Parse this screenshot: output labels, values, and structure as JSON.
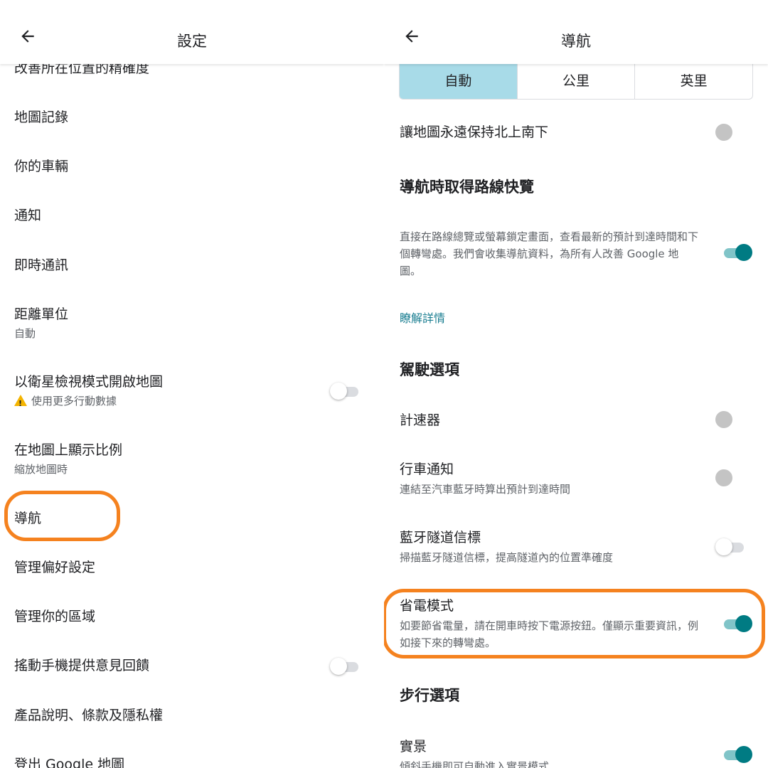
{
  "left": {
    "title": "設定",
    "items": [
      {
        "title": "改善所在位置的精確度"
      },
      {
        "title": "地圖記錄"
      },
      {
        "title": "你的車輛"
      },
      {
        "title": "通知"
      },
      {
        "title": "即時通訊"
      },
      {
        "title": "距離單位",
        "subtitle": "自動"
      },
      {
        "title": "以衛星檢視模式開啟地圖",
        "subtitle": "使用更多行動數據",
        "toggle": "off"
      },
      {
        "title": "在地圖上顯示比例",
        "subtitle": "縮放地圖時"
      },
      {
        "title": "導航"
      },
      {
        "title": "管理偏好設定"
      },
      {
        "title": "管理你的區域"
      },
      {
        "title": "搖動手機提供意見回饋",
        "toggle": "off"
      },
      {
        "title": "產品說明、條款及隱私權"
      },
      {
        "title": "登出 Google 地圖"
      }
    ]
  },
  "right": {
    "title": "導航",
    "units": {
      "options": [
        "自動",
        "公里",
        "英里"
      ],
      "selected": "自動"
    },
    "north_up": {
      "title": "讓地圖永遠保持北上南下",
      "toggle": "disabled"
    },
    "route_overview": {
      "header": "導航時取得路線快覽",
      "description": "直接在路線總覽或螢幕鎖定畫面，查看最新的預計到達時間和下個轉彎處。我們會收集導航資料，為所有人改善 Google 地圖。",
      "toggle": "on",
      "link": "瞭解詳情"
    },
    "driving_header": "駕駛選項",
    "speedometer": {
      "title": "計速器",
      "toggle": "disabled"
    },
    "drive_notifications": {
      "title": "行車通知",
      "subtitle": "連結至汽車藍牙時算出預計到達時間",
      "toggle": "disabled"
    },
    "bt_beacons": {
      "title": "藍牙隧道信標",
      "subtitle": "掃描藍牙隧道信標，提高隧道內的位置準確度",
      "toggle": "off"
    },
    "power_saving": {
      "title": "省電模式",
      "subtitle": "如要節省電量，請在開車時按下電源按鈕。僅顯示重要資訊，例如接下來的轉彎處。",
      "toggle": "on"
    },
    "walking_header": "步行選項",
    "live_view": {
      "title": "實景",
      "subtitle": "傾斜手機即可自動進入實景模式",
      "toggle": "on"
    }
  },
  "colors": {
    "highlight": "#f5821f",
    "toggle_on": "#007b83",
    "selected_segment": "#a8dbe8",
    "link": "#1a7e91"
  }
}
